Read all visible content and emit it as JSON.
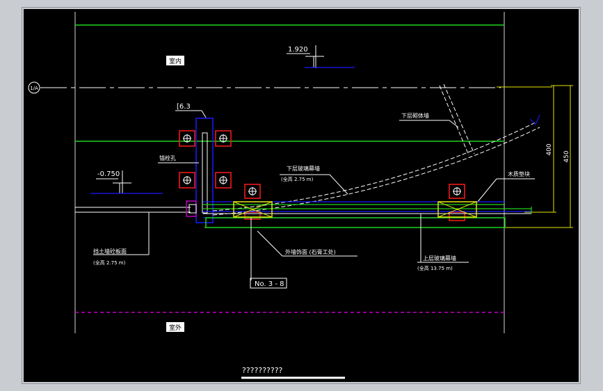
{
  "labels": {
    "room_in": "室内",
    "room_out": "室外",
    "elev_upper": "1.920",
    "elev_lower": "-0.750",
    "axis_tag": "1/A",
    "channel": "[6.3",
    "lower_wall": "下层砌体墙",
    "anchor_bolt": "锚栓孔",
    "lower_panel": "下层玻璃幕墙",
    "lower_panel_sub": "(全高 2.75  m)",
    "wood_strip": "木质垫块",
    "dim_400": "400",
    "dim_450": "450",
    "cornice": "挡土墙砼板面",
    "cornice_sub": "(全高 2.75  m)",
    "ext_wall": "外墙饰面 (石膏工处)",
    "detail_ref": "No. 3 - 8",
    "upper_panel": "上层玻璃幕墙",
    "upper_panel_sub": "(全高 13.75  m)",
    "caption": "??????????"
  },
  "colors": {
    "background": "#000000",
    "green": "#1fd41f",
    "blue": "#1a1aff",
    "red": "#ff1a1a",
    "yellow": "#e6e600",
    "magenta": "#c000c0",
    "white": "#ffffff"
  }
}
